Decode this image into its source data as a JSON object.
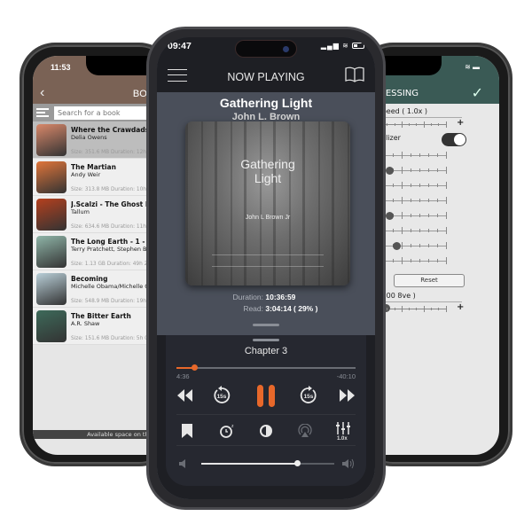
{
  "left_phone": {
    "status_time": "11:53",
    "header_title": "BOOKS",
    "back_icon": "chevron-left-icon",
    "search_placeholder": "Search for a book",
    "books": [
      {
        "title": "Where the Crawdads Sin",
        "author": "Delia Owens",
        "meta": "Size: 351.6 MB  Duration: 12h",
        "cover_color": "#d9886a"
      },
      {
        "title": "The Martian",
        "author": "Andy Weir",
        "meta": "Size: 313.8 MB  Duration: 10h",
        "cover_color": "#e0753a"
      },
      {
        "title": "J.Scalzi - The Ghost Brig",
        "author": "Tallum",
        "meta": "Size: 634.6 MB  Duration: 11h",
        "cover_color": "#b5401e"
      },
      {
        "title": "The Long Earth - 1 - The",
        "author": "Terry Pratchett, Stephen Baxt",
        "meta": "Size: 1.13 GB  Duration: 49h 2",
        "cover_color": "#8fb5a8"
      },
      {
        "title": "Becoming",
        "author": "Michelle Obama/Michelle Oba",
        "meta": "Size: 548.9 MB  Duration: 19h",
        "cover_color": "#b9cfd8"
      },
      {
        "title": "The Bitter Earth",
        "author": "A.R. Shaw",
        "meta": "Size: 151.6 MB  Duration: 5h 0",
        "cover_color": "#3d6a5a"
      }
    ],
    "footer": "Available space on the device"
  },
  "right_phone": {
    "header_title": "PROCESSING",
    "confirm_icon": "check-icon",
    "playback_speed_label": "back speed ( 1.0x )",
    "equalizer_label": "Equalizer",
    "equalizer_on": true,
    "eq_bands": [
      -0.8,
      0.1,
      -0.5,
      -0.7,
      0.1,
      -0.3,
      0.3,
      -0.2
    ],
    "reset_label": "Reset",
    "pitch_label": "itch ( 0.00 8ve )",
    "plus_label": "+"
  },
  "center_phone": {
    "status_time": "09:47",
    "header_title": "NOW PLAYING",
    "book_title": "Gathering Light",
    "book_author": "John L. Brown",
    "cover": {
      "title_line1": "Gathering",
      "title_line2": "Light",
      "author": "John L Brown Jr"
    },
    "duration_label": "Duration:",
    "duration_value": "10:36:59",
    "read_label": "Read:",
    "read_value": "3:04:14 ( 29% )",
    "chapter": "Chapter 3",
    "elapsed": "4:36",
    "remaining": "-40:10",
    "chapter_progress": 0.1,
    "skip_back_label": "15s",
    "skip_forward_label": "15s",
    "speed_label": "1.0x",
    "volume": 0.72,
    "accent_color": "#e8682a"
  }
}
